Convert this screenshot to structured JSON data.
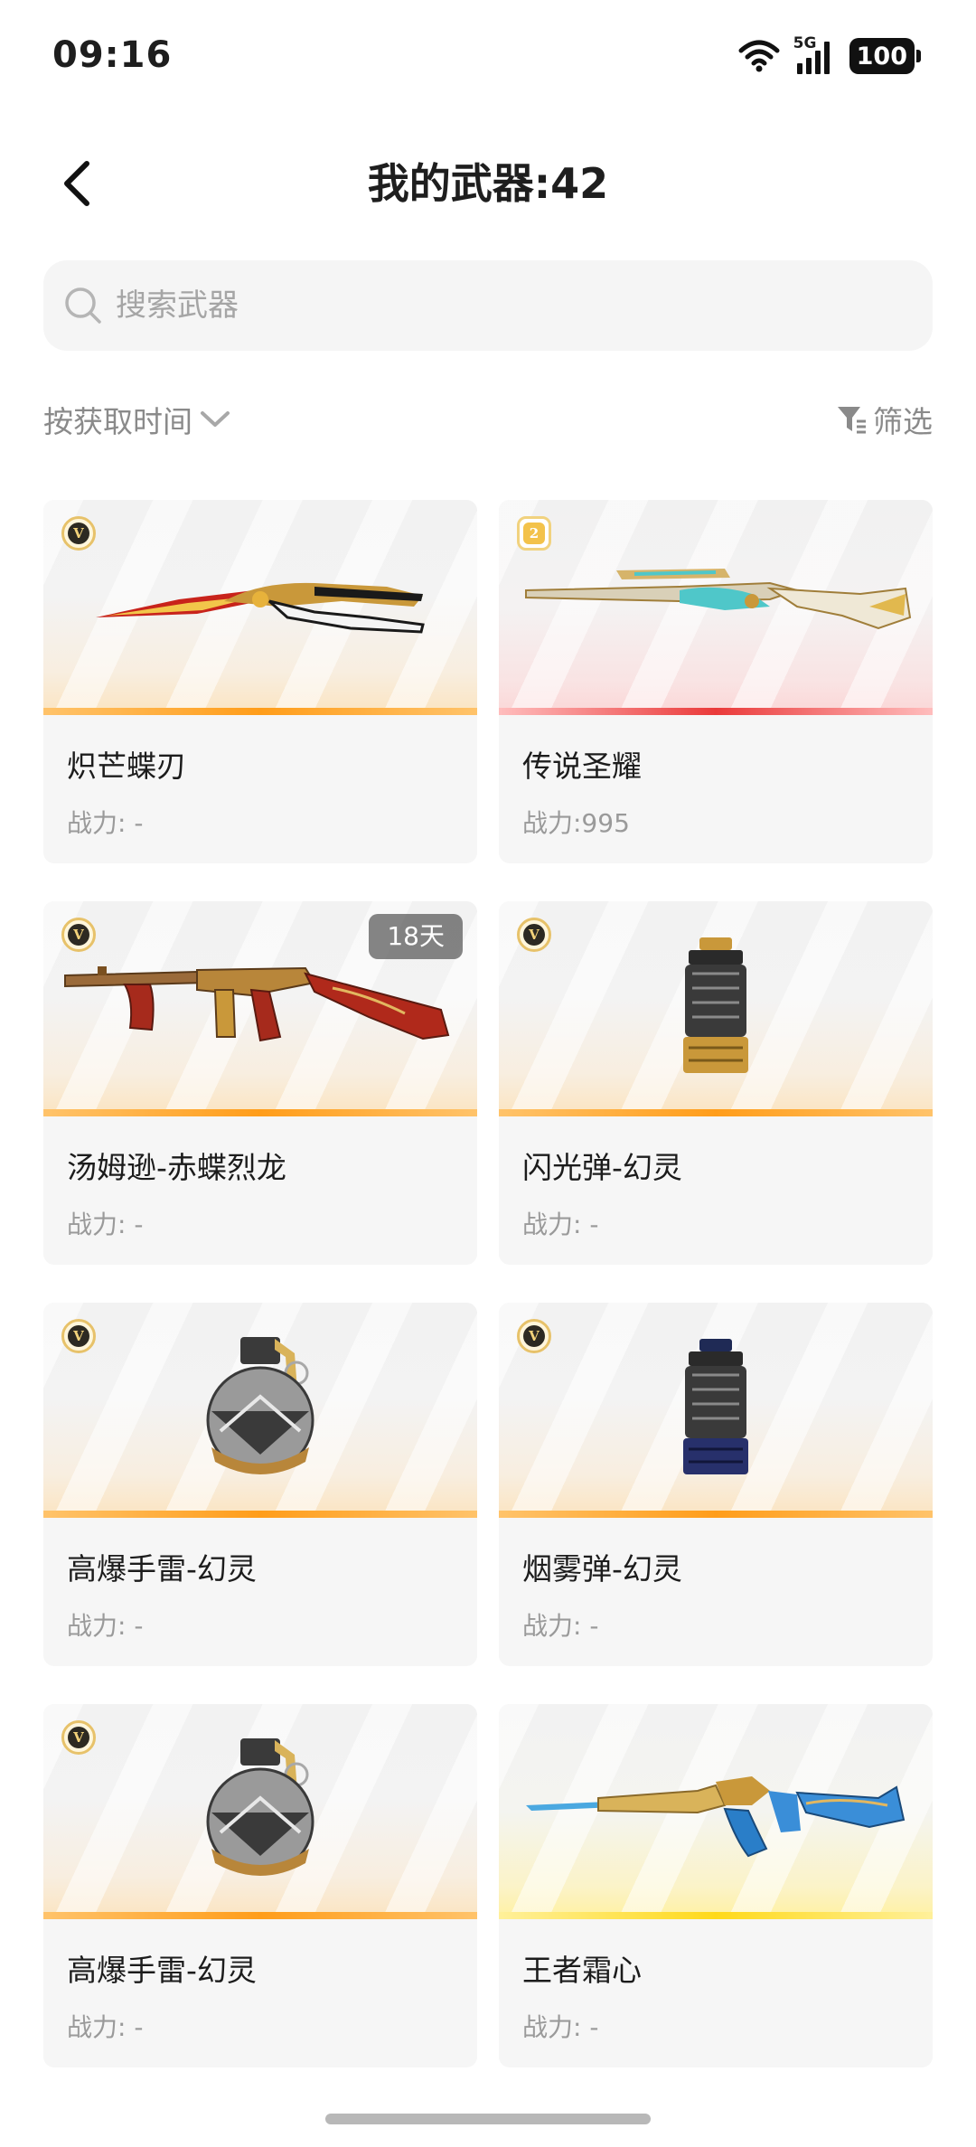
{
  "status_bar": {
    "time": "09:16",
    "network": "5G",
    "battery": "100"
  },
  "header": {
    "title": "我的武器:42"
  },
  "search": {
    "placeholder": "搜索武器"
  },
  "sort": {
    "label": "按获取时间"
  },
  "filter": {
    "label": "筛选"
  },
  "colors": {
    "orange_rarity": "#ff9d1a",
    "red_rarity": "#ea3a3a",
    "yellow_rarity": "#ffd91a"
  },
  "weapons": [
    {
      "name": "炽芒蝶刃",
      "power": "战力: -",
      "badge": "V",
      "rarity": "orange",
      "icon": "butterfly-knife-icon"
    },
    {
      "name": "传说圣耀",
      "power": "战力:995",
      "badge": "2",
      "rarity": "red",
      "icon": "sniper-rifle-icon"
    },
    {
      "name": "汤姆逊-赤蝶烈龙",
      "power": "战力: -",
      "badge": "V",
      "tag": "18天",
      "rarity": "orange",
      "icon": "tommy-gun-icon"
    },
    {
      "name": "闪光弹-幻灵",
      "power": "战力: -",
      "badge": "V",
      "rarity": "orange",
      "icon": "flashbang-icon"
    },
    {
      "name": "高爆手雷-幻灵",
      "power": "战力: -",
      "badge": "V",
      "rarity": "orange",
      "icon": "frag-grenade-icon"
    },
    {
      "name": "烟雾弹-幻灵",
      "power": "战力: -",
      "badge": "V",
      "rarity": "orange",
      "icon": "smoke-grenade-icon"
    },
    {
      "name": "高爆手雷-幻灵",
      "power": "战力: -",
      "badge": "V",
      "rarity": "orange",
      "icon": "frag-grenade-icon"
    },
    {
      "name": "王者霜心",
      "power": "战力: -",
      "rarity": "yellow",
      "icon": "assault-rifle-icon"
    }
  ]
}
